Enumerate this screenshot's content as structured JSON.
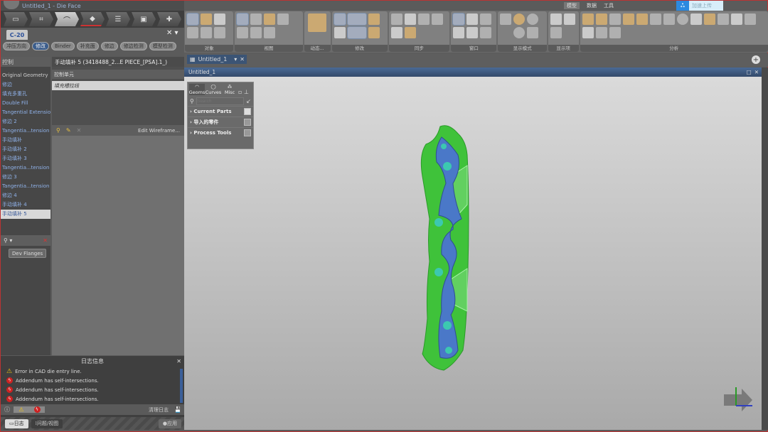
{
  "window": {
    "title": "Untitled_1 - Die Face"
  },
  "workflow": {
    "steps": [
      "import",
      "blank",
      "die-face",
      "trim",
      "process",
      "report",
      "check"
    ],
    "active": 2
  },
  "part_tab": {
    "label": "C-20"
  },
  "chips": [
    "冲压方向",
    "修改",
    "Binder",
    "补充面",
    "修边",
    "修边检测",
    "模型检测"
  ],
  "left_list": {
    "header": "控制",
    "items": [
      "Original Geometry",
      "修边",
      "填充多重孔",
      "Double Fill",
      "Tangential Extension",
      "修边 2",
      "Tangentia...tension 2",
      "手动填补",
      "手动填补 2",
      "手动填补 3",
      "Tangentia...tension 3",
      "修边 3",
      "Tangentia...tension 4",
      "修边 4",
      "手动填补 4",
      "手动填补 5"
    ],
    "selected": 15
  },
  "mid_panel": {
    "title": "手动填补 5 (3418488_2...E PIECE_[PSA].1_)",
    "section": "控制单元",
    "row": "填充槽拉线",
    "edit_button": "Edit Wireframe..."
  },
  "dev_flanges": "Dev Flanges",
  "log": {
    "title": "日志信息",
    "entries": [
      {
        "type": "warning",
        "text": "Error in CAD die entry line."
      },
      {
        "type": "error",
        "text": "Addendum has self-intersections."
      },
      {
        "type": "error",
        "text": "Addendum has self-intersections."
      },
      {
        "type": "error",
        "text": "Addendum has self-intersections."
      }
    ],
    "clear": "清理日志"
  },
  "bottom_tabs": {
    "log": "日志",
    "issues": "问题/视图",
    "apply": "应用"
  },
  "ribbon": {
    "top_tabs": [
      "模型",
      "数据",
      "工具"
    ],
    "cloud": "加速上传",
    "groups": [
      "对象",
      "视图",
      "动态...",
      "修改",
      "同步",
      "窗口",
      "显示模式",
      "显示项",
      "分析"
    ]
  },
  "document": {
    "tab": "Untitled_1",
    "viewport_title": "Untitled_1"
  },
  "float_panel": {
    "tabs": [
      "Geoms",
      "Curves",
      "Misc"
    ],
    "search_placeholder": "Search",
    "rows": [
      "Current Parts",
      "导入的零件",
      "Process Tools"
    ]
  },
  "colors": {
    "part_green": "#3fc23a",
    "part_blue": "#4a78c8",
    "titlebar_blue": "#3b5475"
  }
}
